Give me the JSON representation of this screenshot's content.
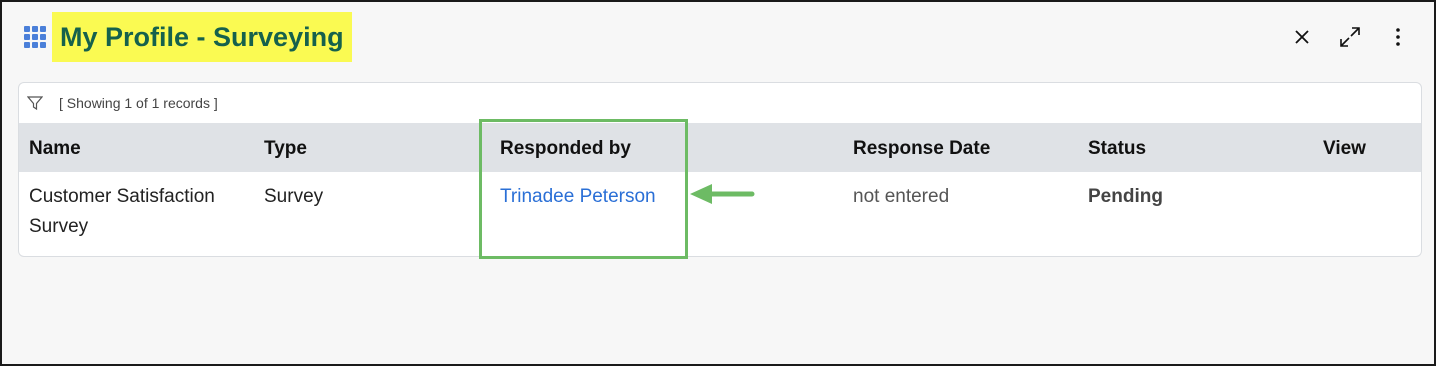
{
  "header": {
    "title": "My Profile - Surveying",
    "icons": {
      "apps": "grid-icon",
      "close": "close-icon",
      "expand": "expand-icon",
      "more": "more-vertical-icon"
    }
  },
  "table": {
    "records_info": "[ Showing 1 of 1 records ]",
    "columns": [
      "Name",
      "Type",
      "Responded by",
      "Response Date",
      "Status",
      "View"
    ],
    "rows": [
      {
        "name": "Customer Satisfaction Survey",
        "type": "Survey",
        "responded_by": "Trinadee Peterson",
        "response_date": "not entered",
        "status": "Pending",
        "view": ""
      }
    ]
  },
  "colors": {
    "title_highlight": "#fafa52",
    "title_text": "#15614c",
    "annotation": "#6dbb64",
    "link": "#2a6fd6"
  }
}
